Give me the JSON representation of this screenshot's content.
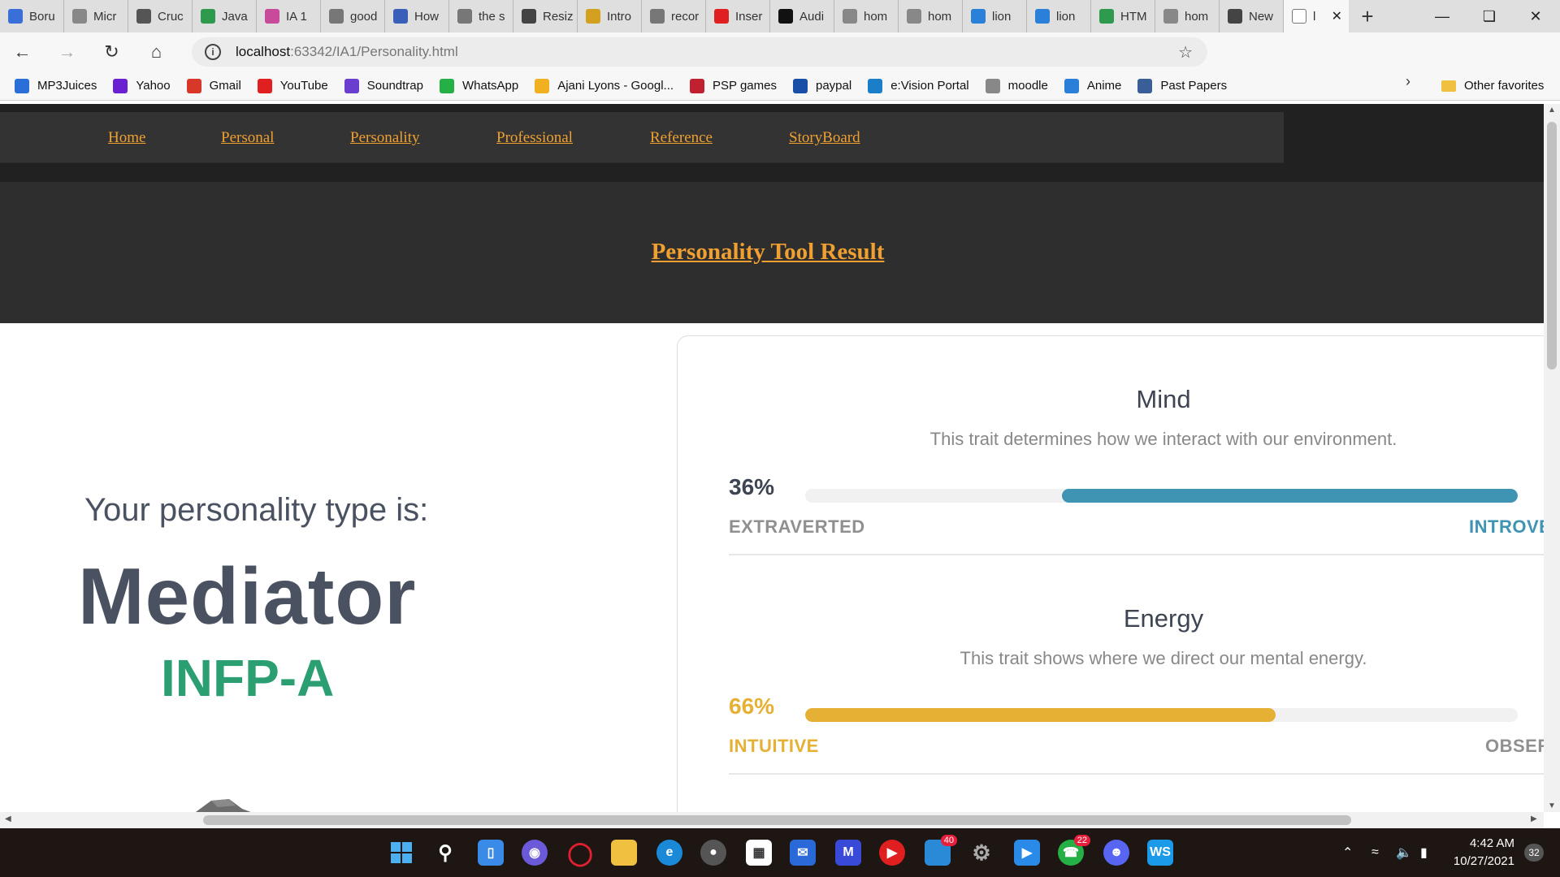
{
  "browser": {
    "tabs": [
      {
        "label": "Boru",
        "icon": "edge-icon",
        "color": "#3a6fd8"
      },
      {
        "label": "Micr",
        "icon": "page-icon",
        "color": "#888888"
      },
      {
        "label": "Cruc",
        "icon": "amazon-icon",
        "color": "#555555"
      },
      {
        "label": "Java",
        "icon": "w3schools-icon",
        "color": "#2e9a4e"
      },
      {
        "label": "IA 1",
        "icon": "ia-icon",
        "color": "#c84a9a"
      },
      {
        "label": "good",
        "icon": "google-icon",
        "color": "#777777"
      },
      {
        "label": "How",
        "icon": "info-icon",
        "color": "#3a5fb8"
      },
      {
        "label": "the s",
        "icon": "google-icon",
        "color": "#777777"
      },
      {
        "label": "Resiz",
        "icon": "resize-icon",
        "color": "#444444"
      },
      {
        "label": "Intro",
        "icon": "sparkle-icon",
        "color": "#d4a020"
      },
      {
        "label": "recor",
        "icon": "google-icon",
        "color": "#777777"
      },
      {
        "label": "Inser",
        "icon": "youtube-icon",
        "color": "#e02020"
      },
      {
        "label": "Audi",
        "icon": "jetbrains-icon",
        "color": "#111111"
      },
      {
        "label": "hom",
        "icon": "page-icon",
        "color": "#888888"
      },
      {
        "label": "hom",
        "icon": "page-icon",
        "color": "#888888"
      },
      {
        "label": "lion",
        "icon": "bing-icon",
        "color": "#2a7fd8"
      },
      {
        "label": "lion",
        "icon": "bing-icon",
        "color": "#2a7fd8"
      },
      {
        "label": "HTM",
        "icon": "w3schools-icon",
        "color": "#2e9a4e"
      },
      {
        "label": "hom",
        "icon": "page-icon",
        "color": "#888888"
      },
      {
        "label": "New",
        "icon": "newtab-icon",
        "color": "#444444"
      }
    ],
    "active_tab_label": "l",
    "url_host": "localhost",
    "url_path": ":63342/IA1/Personality.html",
    "bookmarks": [
      {
        "label": "MP3Juices",
        "icon": "download-icon",
        "color": "#2a6fd8"
      },
      {
        "label": "Yahoo",
        "icon": "yahoo-icon",
        "color": "#6a1fd0"
      },
      {
        "label": "Gmail",
        "icon": "gmail-icon",
        "color": "#d8382a"
      },
      {
        "label": "YouTube",
        "icon": "youtube-icon",
        "color": "#e02020"
      },
      {
        "label": "Soundtrap",
        "icon": "soundtrap-icon",
        "color": "#6a3fd0"
      },
      {
        "label": "WhatsApp",
        "icon": "whatsapp-icon",
        "color": "#25b045"
      },
      {
        "label": "Ajani Lyons - Googl...",
        "icon": "drive-icon",
        "color": "#f0b020"
      },
      {
        "label": "PSP games",
        "icon": "game-icon",
        "color": "#c02030"
      },
      {
        "label": "paypal",
        "icon": "paypal-icon",
        "color": "#1a4fa8"
      },
      {
        "label": "e:Vision Portal",
        "icon": "evision-icon",
        "color": "#1a7fc8"
      },
      {
        "label": "moodle",
        "icon": "moodle-icon",
        "color": "#888888"
      },
      {
        "label": "Anime",
        "icon": "anime-icon",
        "color": "#2a7fd8"
      },
      {
        "label": "Past Papers",
        "icon": "globe-icon",
        "color": "#3a5f98"
      }
    ],
    "other_favorites": "Other favorites"
  },
  "site": {
    "nav": [
      "Home",
      "Personal",
      "Personality",
      "Professional",
      "Reference",
      "StoryBoard"
    ],
    "title": "Personality Tool Result",
    "accent": "#f0a030"
  },
  "result": {
    "label": "Your personality type is:",
    "name": "Mediator",
    "code": "INFP-A",
    "code_color": "#2b9e72"
  },
  "traits": [
    {
      "title": "Mind",
      "description": "This trait determines how we interact with our environment.",
      "percent_label": "36%",
      "percent": 36,
      "fill_side": "right",
      "left_label": "EXTRAVERTED",
      "right_label": "INTROVE",
      "color": "#3f94b4",
      "muted": "#909090"
    },
    {
      "title": "Energy",
      "description": "This trait shows where we direct our mental energy.",
      "percent_label": "66%",
      "percent": 66,
      "fill_side": "left",
      "left_label": "INTUITIVE",
      "right_label": "OBSER",
      "color": "#e6b035",
      "muted": "#909090"
    }
  ],
  "taskbar": {
    "time": "4:42 AM",
    "date": "10/27/2021",
    "notifications": "32",
    "badges": {
      "store": "40",
      "whatsapp": "22"
    }
  }
}
